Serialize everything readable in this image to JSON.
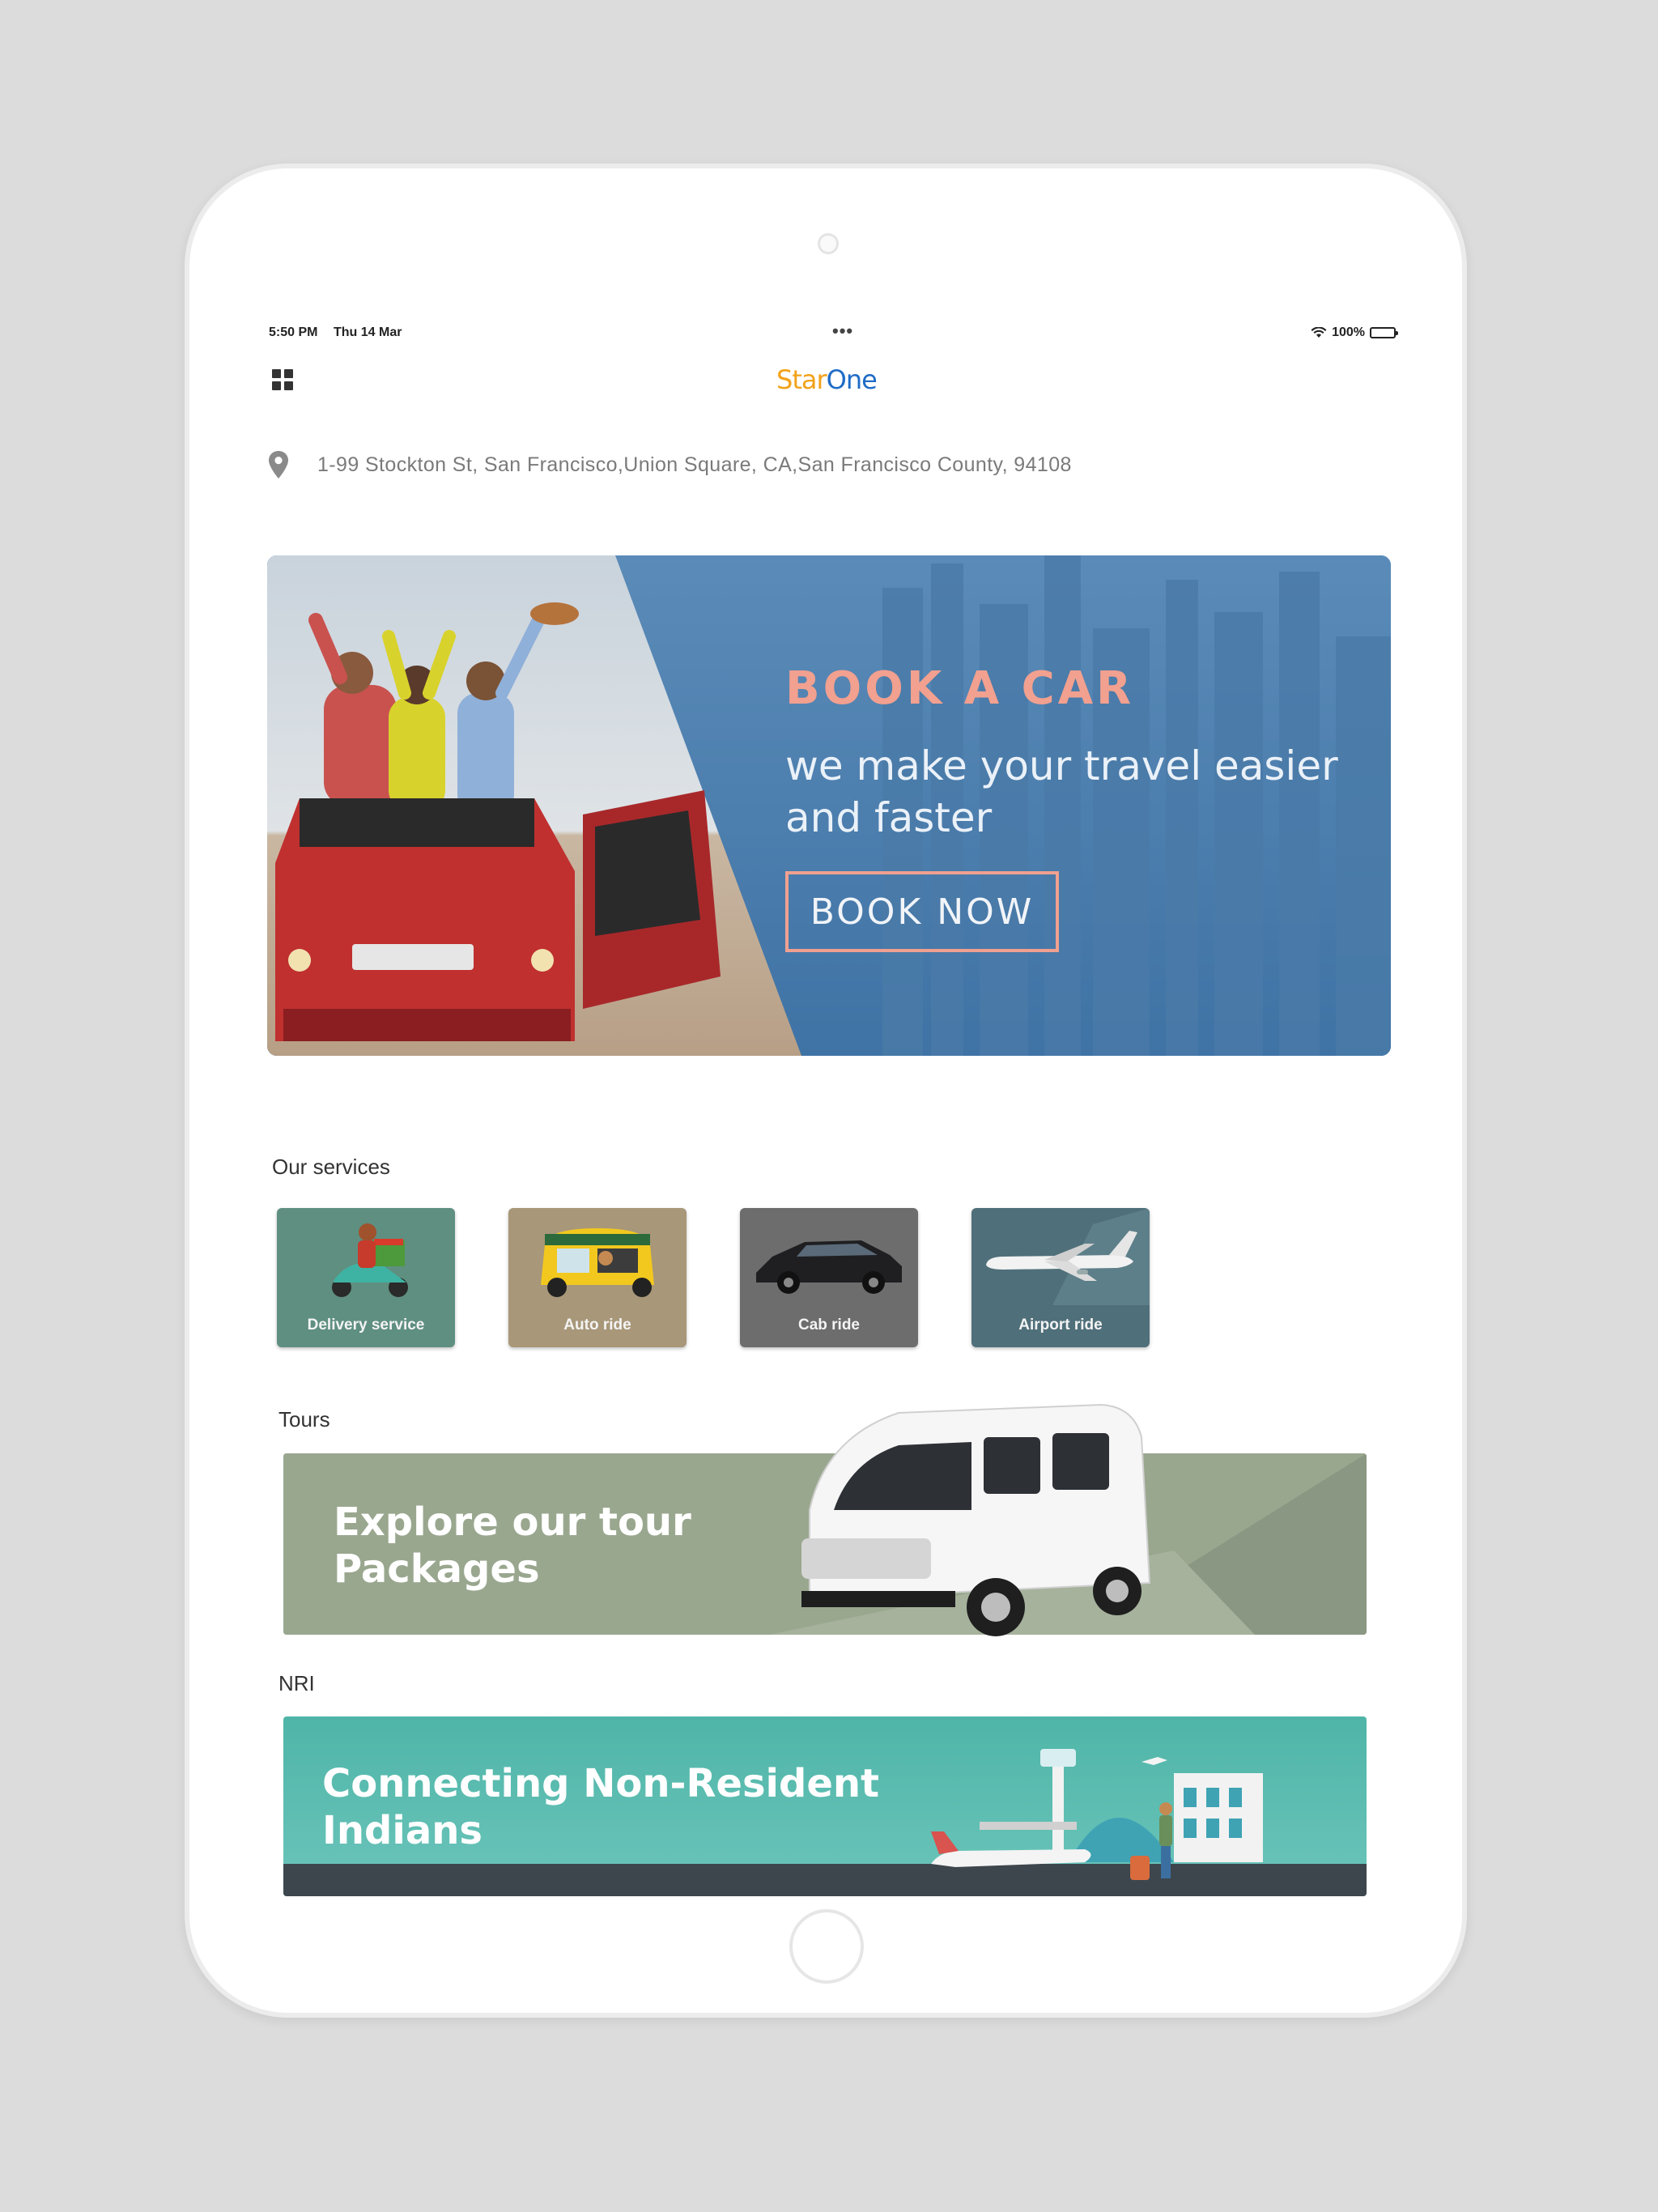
{
  "status_bar": {
    "time": "5:50 PM",
    "date": "Thu 14 Mar",
    "dots": "•••",
    "battery": "100%"
  },
  "header": {
    "logo_part1": "Star",
    "logo_part2": "One"
  },
  "location": {
    "address": "1-99 Stockton St, San Francisco,Union Square, CA,San Francisco County, 94108"
  },
  "hero": {
    "heading": "BOOK A CAR",
    "subtitle": "we make your travel easier and faster",
    "button_label": "BOOK NOW"
  },
  "services": {
    "section_title": "Our services",
    "items": [
      {
        "label": "Delivery service",
        "color": "#5f8f80"
      },
      {
        "label": "Auto ride",
        "color": "#a89779"
      },
      {
        "label": "Cab ride",
        "color": "#6d6d6d"
      },
      {
        "label": "Airport ride",
        "color": "#4f6f7a"
      }
    ]
  },
  "tours": {
    "section_title": "Tours",
    "banner_text": "Explore our tour Packages"
  },
  "nri": {
    "section_title": "NRI",
    "banner_text": "Connecting Non-Resident Indians"
  },
  "colors": {
    "hero_blue": "#4f82b2",
    "hero_accent": "#f2a08f",
    "tours_green": "#9aa78f",
    "nri_teal": "#4fb5a8"
  }
}
